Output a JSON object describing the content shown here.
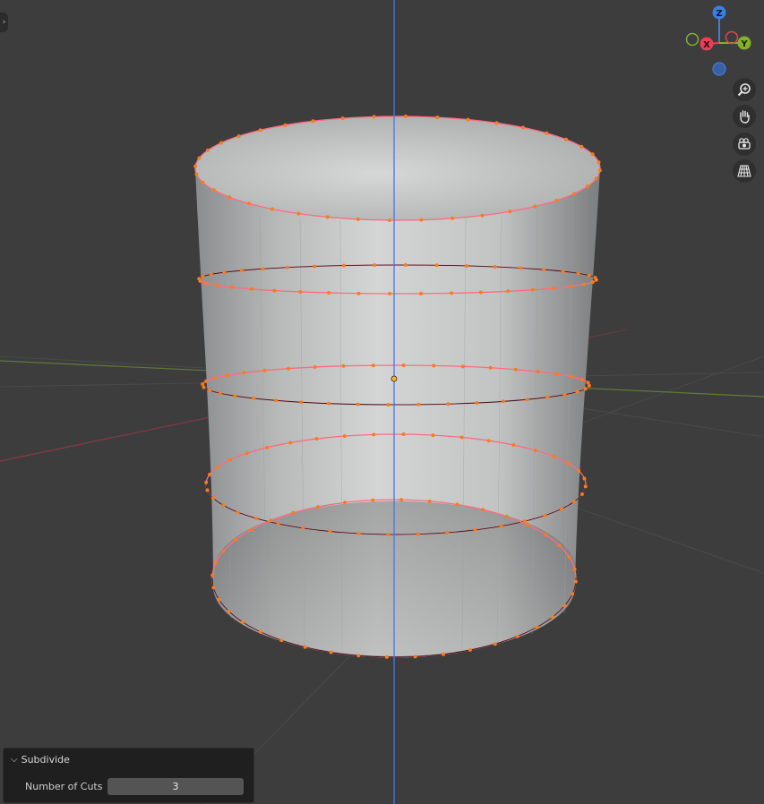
{
  "gizmo": {
    "z_label": "Z",
    "x_label": "X",
    "y_label": "Y"
  },
  "colors": {
    "background": "#3d3d3d",
    "selection": "#ff7a1a",
    "edge_selected": "#ff5a7a",
    "z_axis": "#3b7fe0",
    "x_axis": "#ea3f57",
    "y_axis": "#83b22a"
  },
  "nav_icons": [
    "zoom-icon",
    "pan-hand-icon",
    "camera-view-icon",
    "perspective-grid-icon"
  ],
  "operator_panel": {
    "title": "Subdivide",
    "number_of_cuts_label": "Number of Cuts",
    "number_of_cuts_value": "3"
  }
}
